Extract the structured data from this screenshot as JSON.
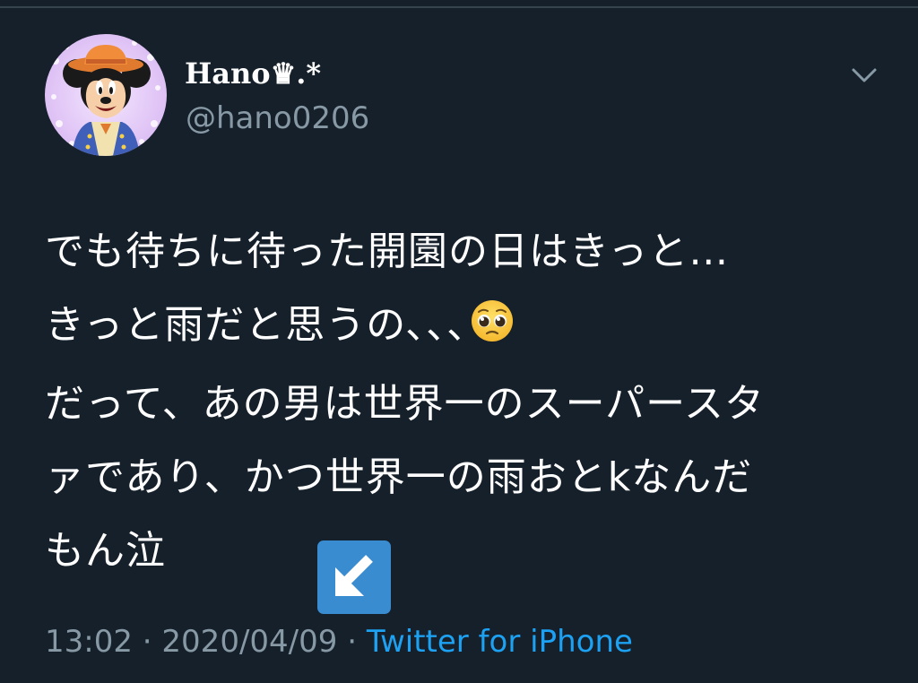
{
  "author": {
    "display_name": "Hano♛.*",
    "handle": "@hano0206"
  },
  "icons": {
    "avatar": "mickey-mouse-avatar",
    "menu": "chevron-down-icon",
    "emoji": "pleading-face-emoji",
    "badge": "down-left-arrow-emoji"
  },
  "tweet": {
    "lines": [
      "でも待ちに待った開園の日はきっと…",
      "きっと雨だと思うの､､､",
      "だって、あの男は世界一のスーパースタ",
      "ァであり、かつ世界一の雨おとkなんだ",
      "もん泣"
    ]
  },
  "meta": {
    "time": "13:02",
    "separator": "·",
    "date": "2020/04/09",
    "source": "Twitter for iPhone"
  },
  "colors": {
    "background": "#15202b",
    "text": "#ffffff",
    "secondary": "#8899a6",
    "link": "#1da1f2",
    "badge": "#3a8cd1"
  }
}
